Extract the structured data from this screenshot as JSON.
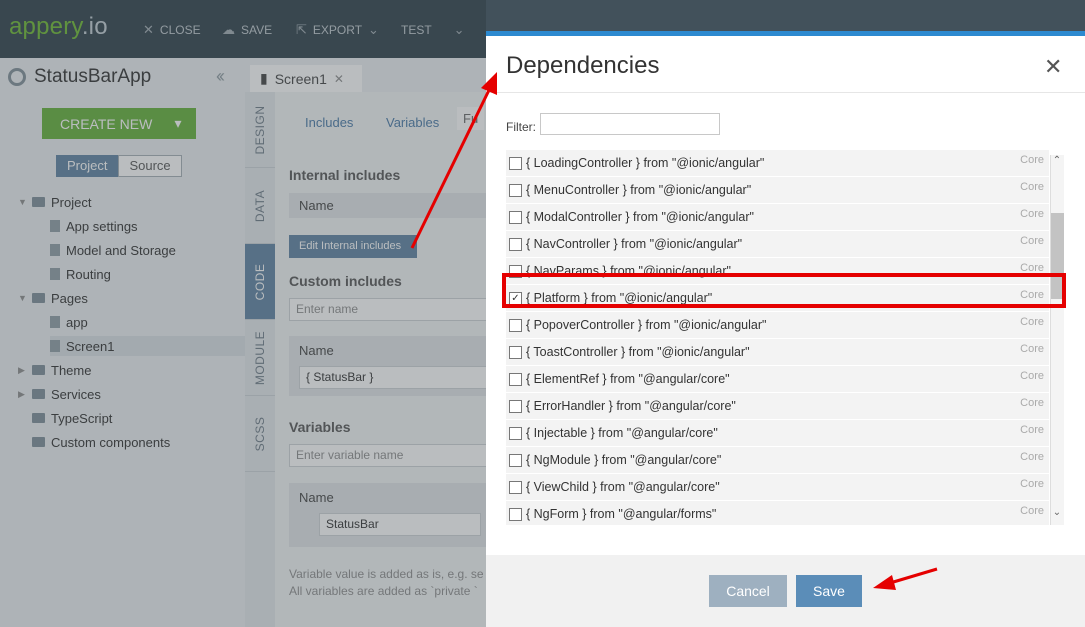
{
  "topbar": {
    "logo_main": "appery",
    "logo_suffix": ".io",
    "buttons": [
      {
        "icon": "close-icon",
        "glyph": "✕",
        "label": "CLOSE"
      },
      {
        "icon": "cloud-upload-icon",
        "glyph": "☁",
        "label": "SAVE"
      },
      {
        "icon": "export-icon",
        "glyph": "⇱",
        "label": "EXPORT"
      },
      {
        "icon": "test-icon",
        "glyph": "",
        "label": "TEST"
      }
    ]
  },
  "sidebar": {
    "app_name": "StatusBarApp",
    "create_new": "CREATE NEW",
    "toggle_project": "Project",
    "toggle_source": "Source",
    "tree": [
      {
        "label": "Project",
        "kind": "folder"
      },
      {
        "label": "App settings",
        "kind": "file"
      },
      {
        "label": "Model and Storage",
        "kind": "file"
      },
      {
        "label": "Routing",
        "kind": "file"
      },
      {
        "label": "Pages",
        "kind": "folder"
      },
      {
        "label": "app",
        "kind": "file"
      },
      {
        "label": "Screen1",
        "kind": "file"
      },
      {
        "label": "Theme",
        "kind": "folder"
      },
      {
        "label": "Services",
        "kind": "folder"
      },
      {
        "label": "TypeScript",
        "kind": "folder"
      },
      {
        "label": "Custom components",
        "kind": "folder"
      }
    ]
  },
  "editor": {
    "tab_label": "Screen1",
    "vtabs": [
      "DESIGN",
      "DATA",
      "CODE",
      "MODULE",
      "SCSS"
    ],
    "active_vtab": "CODE",
    "subtabs": [
      "Includes",
      "Variables",
      "Fu"
    ],
    "internal_includes_title": "Internal includes",
    "name_header": "Name",
    "edit_internal_btn": "Edit Internal includes",
    "custom_includes_title": "Custom includes",
    "custom_placeholder": "Enter name",
    "custom_value": "{ StatusBar }",
    "variables_title": "Variables",
    "variable_placeholder": "Enter variable name",
    "variable_value": "StatusBar",
    "note_line1": "Variable value is added as is, e.g. se",
    "note_line2": "All variables are added as `private `"
  },
  "dialog": {
    "title": "Dependencies",
    "filter_label": "Filter:",
    "filter_value": "",
    "dependencies": [
      {
        "name": "{ LoadingController } from \"@ionic/angular\"",
        "tag": "Core",
        "checked": false
      },
      {
        "name": "{ MenuController } from \"@ionic/angular\"",
        "tag": "Core",
        "checked": false
      },
      {
        "name": "{ ModalController } from \"@ionic/angular\"",
        "tag": "Core",
        "checked": false
      },
      {
        "name": "{ NavController } from \"@ionic/angular\"",
        "tag": "Core",
        "checked": false
      },
      {
        "name": "{ NavParams } from \"@ionic/angular\"",
        "tag": "Core",
        "checked": false
      },
      {
        "name": "{ Platform } from \"@ionic/angular\"",
        "tag": "Core",
        "checked": true
      },
      {
        "name": "{ PopoverController } from \"@ionic/angular\"",
        "tag": "Core",
        "checked": false
      },
      {
        "name": "{ ToastController } from \"@ionic/angular\"",
        "tag": "Core",
        "checked": false
      },
      {
        "name": "{ ElementRef } from \"@angular/core\"",
        "tag": "Core",
        "checked": false
      },
      {
        "name": "{ ErrorHandler } from \"@angular/core\"",
        "tag": "Core",
        "checked": false
      },
      {
        "name": "{ Injectable } from \"@angular/core\"",
        "tag": "Core",
        "checked": false
      },
      {
        "name": "{ NgModule } from \"@angular/core\"",
        "tag": "Core",
        "checked": false
      },
      {
        "name": "{ ViewChild } from \"@angular/core\"",
        "tag": "Core",
        "checked": false
      },
      {
        "name": "{ NgForm } from \"@angular/forms\"",
        "tag": "Core",
        "checked": false
      }
    ],
    "cancel_label": "Cancel",
    "save_label": "Save"
  },
  "colors": {
    "accent_blue": "#2d8ad0",
    "brand_green": "#72b84b",
    "annotation_red": "#e50000"
  }
}
